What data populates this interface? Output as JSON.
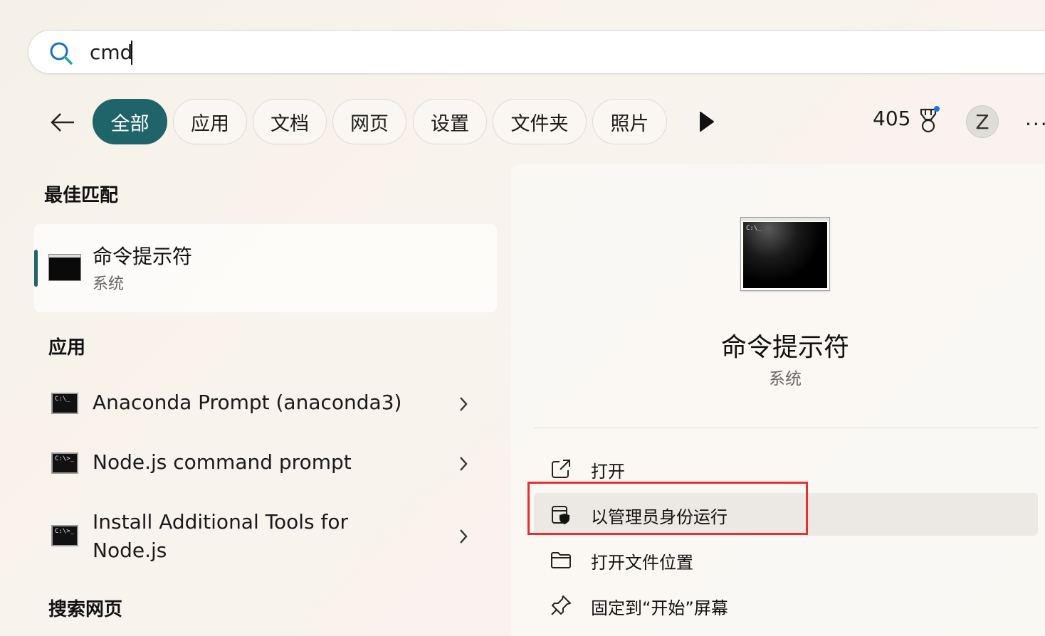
{
  "search": {
    "query": "cmd"
  },
  "filters": {
    "back_label": "",
    "chips": [
      "全部",
      "应用",
      "文档",
      "网页",
      "设置",
      "文件夹",
      "照片"
    ],
    "active_index": 0
  },
  "header": {
    "points": "405",
    "avatar_initial": "Z",
    "more": "···"
  },
  "best_match": {
    "heading": "最佳匹配",
    "title": "命令提示符",
    "subtitle": "系统"
  },
  "apps": {
    "heading": "应用",
    "items": [
      {
        "label": "Anaconda Prompt (anaconda3)",
        "icon_text": "C:\\_"
      },
      {
        "label": "Node.js command prompt",
        "icon_text": "C:\\>_"
      },
      {
        "label": "Install Additional Tools for\nNode.js",
        "icon_text": "C:\\>_"
      }
    ]
  },
  "web": {
    "heading": "搜索网页"
  },
  "detail": {
    "title": "命令提示符",
    "subtitle": "系统",
    "icon_text": "C:\\_",
    "actions": [
      {
        "label": "打开",
        "icon": "open-external-icon"
      },
      {
        "label": "以管理员身份运行",
        "icon": "run-as-admin-shield-icon"
      },
      {
        "label": "打开文件位置",
        "icon": "folder-icon"
      },
      {
        "label": "固定到“开始”屏幕",
        "icon": "pin-icon"
      }
    ]
  },
  "colors": {
    "accent": "#1f6469",
    "highlight": "#e53030"
  }
}
